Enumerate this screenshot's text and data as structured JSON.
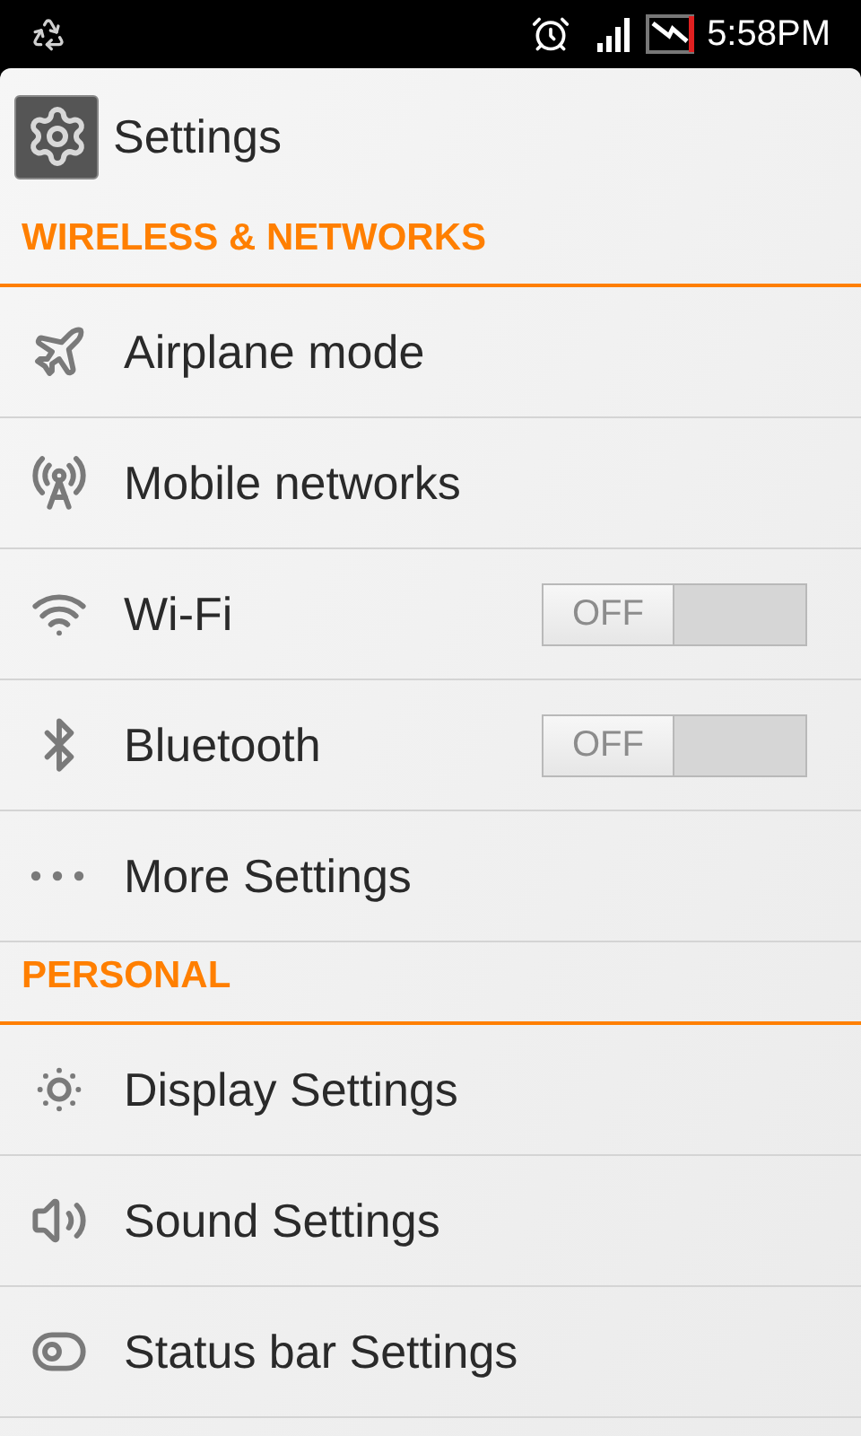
{
  "status_bar": {
    "time": "5:58PM"
  },
  "app_bar": {
    "title": "Settings"
  },
  "sections": [
    {
      "header": "WIRELESS & NETWORKS",
      "items": [
        {
          "kind": "plain",
          "label": "Airplane mode"
        },
        {
          "kind": "plain",
          "label": "Mobile networks"
        },
        {
          "kind": "toggle",
          "label": "Wi-Fi",
          "on": false,
          "state_label": "OFF"
        },
        {
          "kind": "toggle",
          "label": "Bluetooth",
          "on": false,
          "state_label": "OFF"
        },
        {
          "kind": "plain",
          "label": "More Settings"
        }
      ]
    },
    {
      "header": "PERSONAL",
      "items": [
        {
          "kind": "plain",
          "label": "Display Settings"
        },
        {
          "kind": "plain",
          "label": "Sound Settings"
        },
        {
          "kind": "plain",
          "label": "Status bar Settings"
        }
      ]
    }
  ]
}
